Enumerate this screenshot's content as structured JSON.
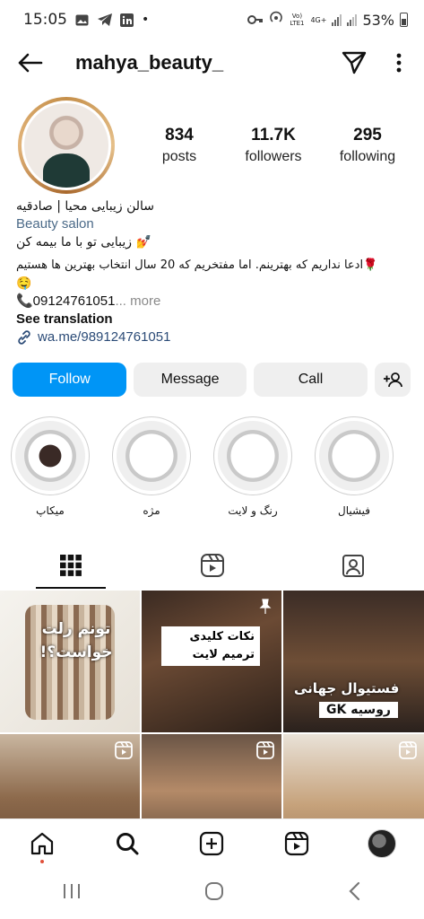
{
  "status_bar": {
    "time": "15:05",
    "carrier": "Vo) LTE1",
    "network": "4G+",
    "battery": "53%",
    "icons": [
      "image-icon",
      "telegram-icon",
      "linkedin-icon",
      "dot-icon",
      "key-icon",
      "hotspot-icon",
      "signal-icon",
      "battery-icon"
    ]
  },
  "header": {
    "username": "mahya_beauty_",
    "icons": [
      "back-arrow-icon",
      "send-icon",
      "more-icon"
    ]
  },
  "profile": {
    "stats": [
      {
        "value": "834",
        "label": "posts"
      },
      {
        "value": "11.7K",
        "label": "followers"
      },
      {
        "value": "295",
        "label": "following"
      }
    ],
    "bio": {
      "name": "سالن زیبایی محیا | صادقیه",
      "category": "Beauty salon",
      "line1": "💅 زیبایی تو با ما بیمه کن",
      "line2": "🌹ادعا نداریم که بهترینم. اما مفتخریم که 20 سال انتخاب بهترین ها هستیم",
      "line3": "🤤",
      "phone": "📞09124761051",
      "more": "... more",
      "see_translation": "See translation",
      "link": "wa.me/989124761051"
    }
  },
  "actions": {
    "follow": "Follow",
    "message": "Message",
    "call": "Call"
  },
  "highlights": [
    {
      "label": "میکاپ"
    },
    {
      "label": "مژه"
    },
    {
      "label": "رنگ و لایت"
    },
    {
      "label": "فیشیال"
    }
  ],
  "tabs": [
    "grid-icon",
    "reels-icon",
    "tagged-icon"
  ],
  "posts": [
    {
      "text": "تونم رلت خواست؟!"
    },
    {
      "text": "نکات کلیدی ترمیم لایت"
    },
    {
      "text": "فستیوال جهانی",
      "badge": "GK روسیه"
    },
    {
      "text": ""
    },
    {
      "text": ""
    },
    {
      "text": ""
    }
  ],
  "bottom_nav": [
    "home-icon",
    "search-icon",
    "add-icon",
    "reels-icon",
    "profile-avatar"
  ],
  "colors": {
    "follow_blue": "#0095f6",
    "link_blue": "#2b4b77",
    "muted_gray": "#8a8a8a"
  }
}
